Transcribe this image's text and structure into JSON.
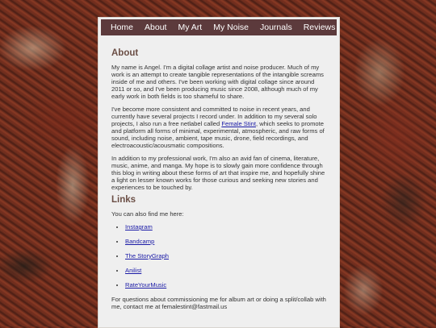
{
  "nav": {
    "items": [
      "Home",
      "About",
      "My Art",
      "My Noise",
      "Journals",
      "Reviews"
    ]
  },
  "about": {
    "heading": "About",
    "p1": "My name is Angel. I'm a digital collage artist and noise producer. Much of my work is an attempt to create tangible representations of the intangible screams inside of me and others. I've been working with digital collage since around 2011 or so, and I've been producing music since 2008, although much of my early work in both fields is too shameful to share.",
    "p2_before": "I've become more consistent and committed to noise in recent years, and currently have several projects I record under. In addition to my several solo projects, I also run a free netlabel called ",
    "p2_link": "Female Stint",
    "p2_after": ", which seeks to promote and platform all forms of minimal, experimental, atmospheric, and raw forms of sound, including noise, ambient, tape music, drone, field recordings, and electroacoustic/acousmatic compositions.",
    "p3": "In addition to my professional work, I'm also an avid fan of cinema, literature, music, anime, and manga. My hope is to slowly gain more confidence through this blog in writing about these forms of art that inspire me, and hopefully shine a light on lesser known works for those curious and seeking new stories and experiences to be touched by."
  },
  "links": {
    "heading": "Links",
    "intro": "You can also find me here:",
    "items": [
      "Instagram",
      "Bandcamp",
      "The StoryGraph",
      "Anilist",
      "RateYourMusic"
    ],
    "footer": "For questions about commissioning me for album art or doing a split/collab with me, contact me at femalestint@fastmail.us"
  },
  "colors": {
    "nav_bg": "#5c3a3c",
    "heading": "#6b4e45",
    "link": "#1a1aa6",
    "panel_bg": "#efefef"
  }
}
